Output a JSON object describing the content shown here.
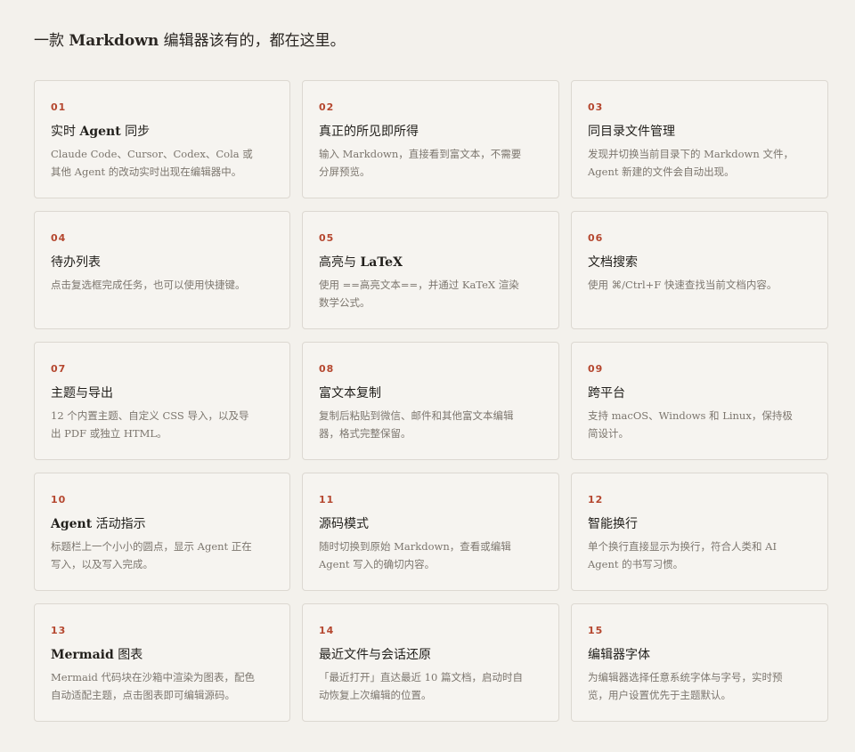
{
  "heading": {
    "prefix": "一款 ",
    "bold": "Markdown",
    "suffix": " 编辑器该有的，都在这里。"
  },
  "features": [
    {
      "number": "01",
      "title_bold": "",
      "title_pre": "实时 ",
      "title_strong": "Agent",
      "title_post": " 同步",
      "desc": "Claude Code、Cursor、Codex、Cola 或其他 Agent 的改动实时出现在编辑器中。"
    },
    {
      "number": "02",
      "title_pre": "真正的所见即所得",
      "title_strong": "",
      "title_post": "",
      "desc": "输入 Markdown，直接看到富文本，不需要分屏预览。"
    },
    {
      "number": "03",
      "title_pre": "同目录文件管理",
      "title_strong": "",
      "title_post": "",
      "desc": "发现并切换当前目录下的 Markdown 文件，Agent 新建的文件会自动出现。"
    },
    {
      "number": "04",
      "title_pre": "待办列表",
      "title_strong": "",
      "title_post": "",
      "desc": "点击复选框完成任务，也可以使用快捷键。"
    },
    {
      "number": "05",
      "title_pre": "高亮与 ",
      "title_strong": "LaTeX",
      "title_post": "",
      "desc": "使用 ==高亮文本==，并通过 KaTeX 渲染数学公式。"
    },
    {
      "number": "06",
      "title_pre": "文档搜索",
      "title_strong": "",
      "title_post": "",
      "desc": "使用 ⌘/Ctrl+F 快速查找当前文档内容。"
    },
    {
      "number": "07",
      "title_pre": "主题与导出",
      "title_strong": "",
      "title_post": "",
      "desc": "12 个内置主题、自定义 CSS 导入，以及导出 PDF 或独立 HTML。"
    },
    {
      "number": "08",
      "title_pre": "富文本复制",
      "title_strong": "",
      "title_post": "",
      "desc": "复制后粘贴到微信、邮件和其他富文本编辑器，格式完整保留。"
    },
    {
      "number": "09",
      "title_pre": "跨平台",
      "title_strong": "",
      "title_post": "",
      "desc": "支持 macOS、Windows 和 Linux，保持极简设计。"
    },
    {
      "number": "10",
      "title_pre": "",
      "title_strong": "Agent",
      "title_post": " 活动指示",
      "desc": "标题栏上一个小小的圆点，显示 Agent 正在写入，以及写入完成。"
    },
    {
      "number": "11",
      "title_pre": "源码模式",
      "title_strong": "",
      "title_post": "",
      "desc": "随时切换到原始 Markdown，查看或编辑 Agent 写入的确切内容。"
    },
    {
      "number": "12",
      "title_pre": "智能换行",
      "title_strong": "",
      "title_post": "",
      "desc": "单个换行直接显示为换行，符合人类和 AI Agent 的书写习惯。"
    },
    {
      "number": "13",
      "title_pre": "",
      "title_strong": "Mermaid",
      "title_post": " 图表",
      "desc": "Mermaid 代码块在沙箱中渲染为图表，配色自动适配主题，点击图表即可编辑源码。"
    },
    {
      "number": "14",
      "title_pre": "最近文件与会话还原",
      "title_strong": "",
      "title_post": "",
      "desc": "「最近打开」直达最近 10 篇文档，启动时自动恢复上次编辑的位置。"
    },
    {
      "number": "15",
      "title_pre": "编辑器字体",
      "title_strong": "",
      "title_post": "",
      "desc": "为编辑器选择任意系统字体与字号，实时预览，用户设置优先于主题默认。"
    }
  ],
  "colors": {
    "accent": "#b5472f",
    "background": "#f3f1ec",
    "card_border": "#dcd8d1"
  }
}
